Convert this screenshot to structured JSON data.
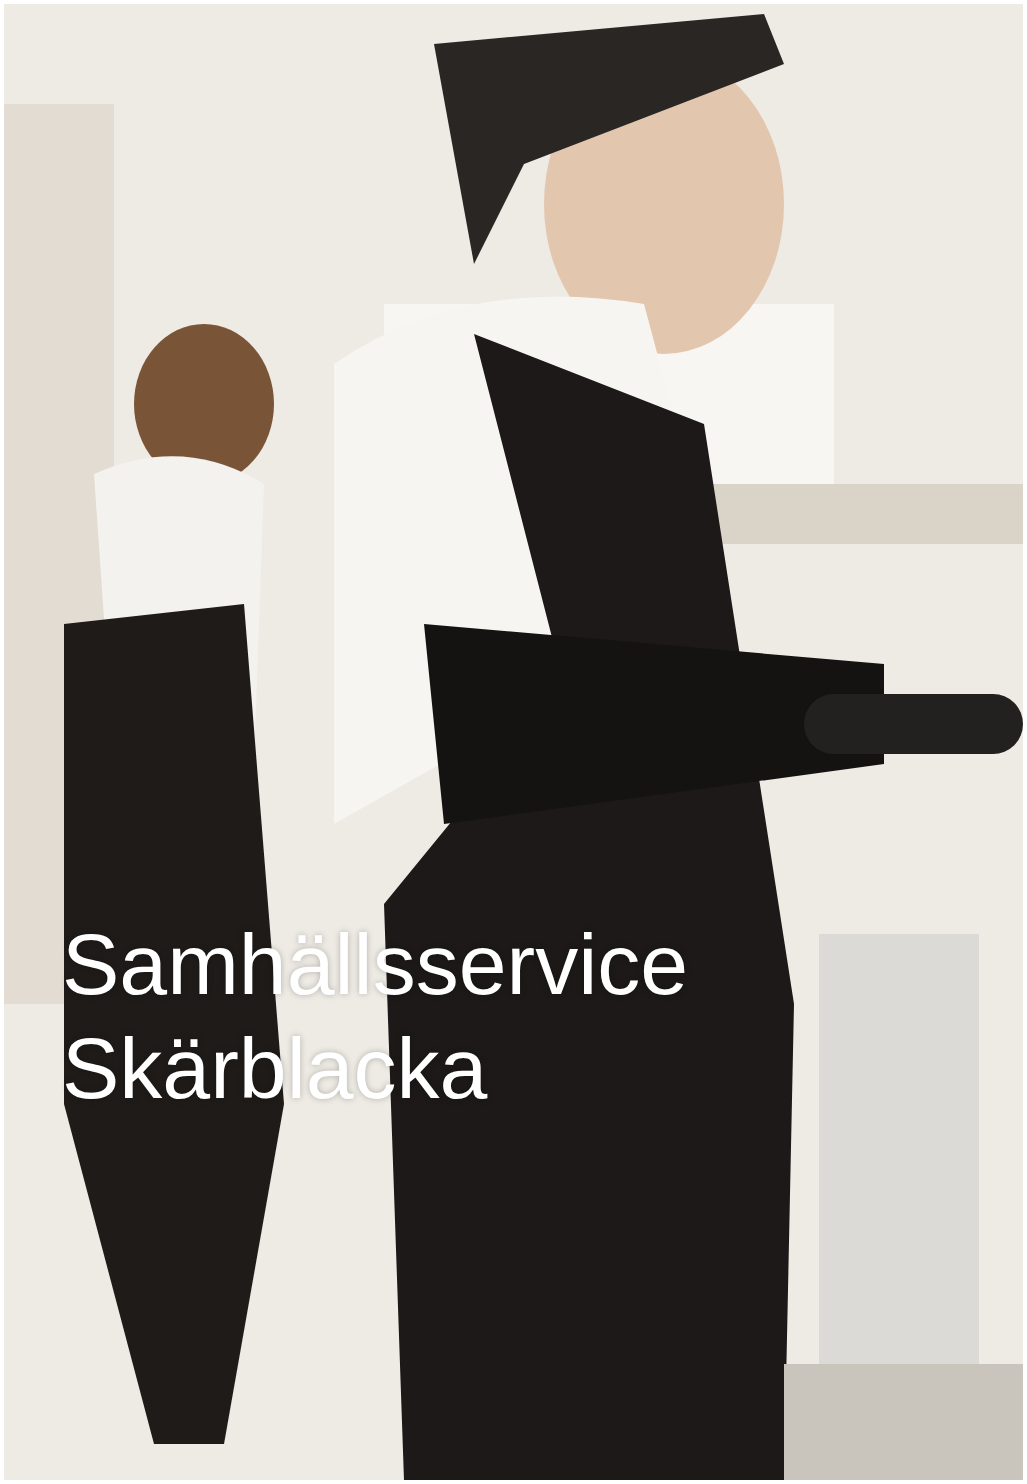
{
  "card": {
    "title_lines": [
      "Samhällsservice",
      "Skärblacka"
    ]
  }
}
